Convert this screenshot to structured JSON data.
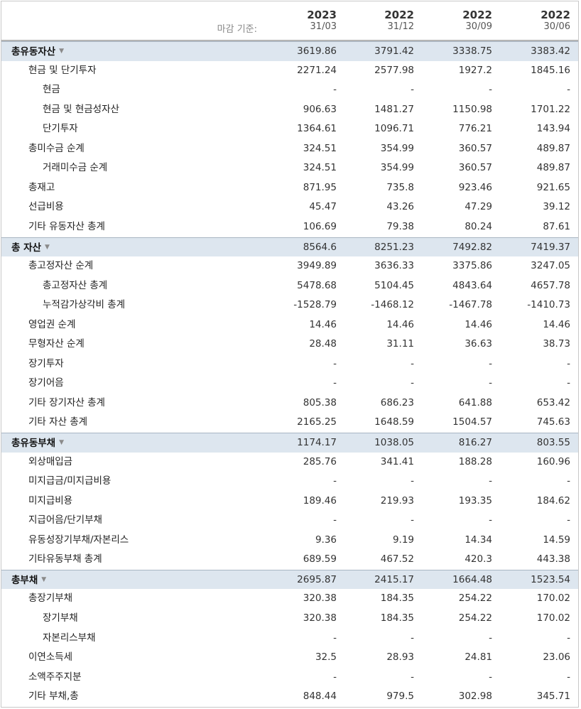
{
  "header": {
    "basis_label": "마감 기준:",
    "columns": [
      {
        "year": "2023",
        "date": "31/03"
      },
      {
        "year": "2022",
        "date": "31/12"
      },
      {
        "year": "2022",
        "date": "30/09"
      },
      {
        "year": "2022",
        "date": "30/06"
      }
    ]
  },
  "rows": [
    {
      "label": "총유동자산",
      "level": 0,
      "section": true,
      "values": [
        "3619.86",
        "3791.42",
        "3338.75",
        "3383.42"
      ]
    },
    {
      "label": "현금 및 단기투자",
      "level": 1,
      "values": [
        "2271.24",
        "2577.98",
        "1927.2",
        "1845.16"
      ]
    },
    {
      "label": "현금",
      "level": 2,
      "values": [
        "-",
        "-",
        "-",
        "-"
      ]
    },
    {
      "label": "현금 및 현금성자산",
      "level": 2,
      "values": [
        "906.63",
        "1481.27",
        "1150.98",
        "1701.22"
      ]
    },
    {
      "label": "단기투자",
      "level": 2,
      "values": [
        "1364.61",
        "1096.71",
        "776.21",
        "143.94"
      ]
    },
    {
      "label": "총미수금 순계",
      "level": 1,
      "values": [
        "324.51",
        "354.99",
        "360.57",
        "489.87"
      ]
    },
    {
      "label": "거래미수금 순계",
      "level": 2,
      "values": [
        "324.51",
        "354.99",
        "360.57",
        "489.87"
      ]
    },
    {
      "label": "총재고",
      "level": 1,
      "values": [
        "871.95",
        "735.8",
        "923.46",
        "921.65"
      ]
    },
    {
      "label": "선급비용",
      "level": 1,
      "values": [
        "45.47",
        "43.26",
        "47.29",
        "39.12"
      ]
    },
    {
      "label": "기타 유동자산 총계",
      "level": 1,
      "values": [
        "106.69",
        "79.38",
        "80.24",
        "87.61"
      ]
    },
    {
      "label": "총 자산",
      "level": 0,
      "section": true,
      "values": [
        "8564.6",
        "8251.23",
        "7492.82",
        "7419.37"
      ]
    },
    {
      "label": "총고정자산 순계",
      "level": 1,
      "values": [
        "3949.89",
        "3636.33",
        "3375.86",
        "3247.05"
      ]
    },
    {
      "label": "총고정자산 총계",
      "level": 2,
      "values": [
        "5478.68",
        "5104.45",
        "4843.64",
        "4657.78"
      ]
    },
    {
      "label": "누적감가상각비 총계",
      "level": 2,
      "values": [
        "-1528.79",
        "-1468.12",
        "-1467.78",
        "-1410.73"
      ]
    },
    {
      "label": "영업권 순계",
      "level": 1,
      "values": [
        "14.46",
        "14.46",
        "14.46",
        "14.46"
      ]
    },
    {
      "label": "무형자산 순계",
      "level": 1,
      "values": [
        "28.48",
        "31.11",
        "36.63",
        "38.73"
      ]
    },
    {
      "label": "장기투자",
      "level": 1,
      "values": [
        "-",
        "-",
        "-",
        "-"
      ]
    },
    {
      "label": "장기어음",
      "level": 1,
      "values": [
        "-",
        "-",
        "-",
        "-"
      ]
    },
    {
      "label": "기타 장기자산 총계",
      "level": 1,
      "values": [
        "805.38",
        "686.23",
        "641.88",
        "653.42"
      ]
    },
    {
      "label": "기타 자산 총계",
      "level": 1,
      "values": [
        "2165.25",
        "1648.59",
        "1504.57",
        "745.63"
      ]
    },
    {
      "label": "총유동부채",
      "level": 0,
      "section": true,
      "values": [
        "1174.17",
        "1038.05",
        "816.27",
        "803.55"
      ]
    },
    {
      "label": "외상매입금",
      "level": 1,
      "values": [
        "285.76",
        "341.41",
        "188.28",
        "160.96"
      ]
    },
    {
      "label": "미지급금/미지급비용",
      "level": 1,
      "values": [
        "-",
        "-",
        "-",
        "-"
      ]
    },
    {
      "label": "미지급비용",
      "level": 1,
      "values": [
        "189.46",
        "219.93",
        "193.35",
        "184.62"
      ]
    },
    {
      "label": "지급어음/단기부채",
      "level": 1,
      "values": [
        "-",
        "-",
        "-",
        "-"
      ]
    },
    {
      "label": "유동성장기부채/자본리스",
      "level": 1,
      "values": [
        "9.36",
        "9.19",
        "14.34",
        "14.59"
      ]
    },
    {
      "label": "기타유동부채 총계",
      "level": 1,
      "values": [
        "689.59",
        "467.52",
        "420.3",
        "443.38"
      ]
    },
    {
      "label": "총부채",
      "level": 0,
      "section": true,
      "values": [
        "2695.87",
        "2415.17",
        "1664.48",
        "1523.54"
      ]
    },
    {
      "label": "총장기부채",
      "level": 1,
      "values": [
        "320.38",
        "184.35",
        "254.22",
        "170.02"
      ]
    },
    {
      "label": "장기부채",
      "level": 2,
      "values": [
        "320.38",
        "184.35",
        "254.22",
        "170.02"
      ]
    },
    {
      "label": "자본리스부채",
      "level": 2,
      "values": [
        "-",
        "-",
        "-",
        "-"
      ]
    },
    {
      "label": "이연소득세",
      "level": 1,
      "values": [
        "32.5",
        "28.93",
        "24.81",
        "23.06"
      ]
    },
    {
      "label": "소액주주지분",
      "level": 1,
      "values": [
        "-",
        "-",
        "-",
        "-"
      ]
    },
    {
      "label": "기타 부채,총",
      "level": 1,
      "values": [
        "848.44",
        "979.5",
        "302.98",
        "345.71"
      ]
    }
  ]
}
